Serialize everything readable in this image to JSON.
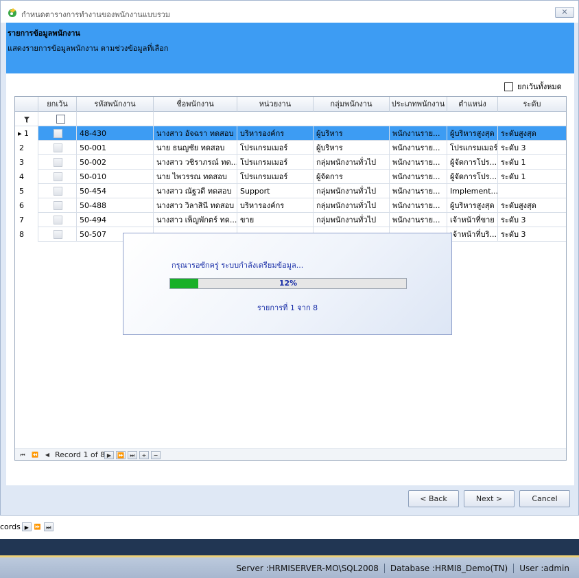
{
  "window": {
    "title": "กำหนดตารางการทำงานของพนักงานแบบรวม",
    "close_label": "✕"
  },
  "banner": {
    "heading": "รายการข้อมูลพนักงาน",
    "description": "แสดงรายการข้อมูลพนักงาน ตามช่วงข้อมูลที่เลือก"
  },
  "exclude_all_label": "ยกเว้นทั้งหมด",
  "grid": {
    "columns": [
      "ยกเว้น",
      "รหัสพนักงาน",
      "ชื่อพนักงาน",
      "หน่วยงาน",
      "กลุ่มพนักงาน",
      "ประเภทพนักงาน",
      "ตำแหน่ง",
      "ระดับ"
    ],
    "filter_icon": "filter-icon",
    "rows": [
      {
        "no": "1",
        "code": "48-430",
        "name": "นางสาว อัจฉรา ทดสอบ",
        "dept": "บริหารองค์กร",
        "group": "ผู้บริหาร",
        "type": "พนักงานราย...",
        "position": "ผู้บริหารสูงสุด",
        "level": "ระดับสูงสุด"
      },
      {
        "no": "2",
        "code": "50-001",
        "name": "นาย ธนญชัย ทดสอบ",
        "dept": "โปรแกรมเมอร์",
        "group": "ผู้บริหาร",
        "type": "พนักงานราย...",
        "position": "โปรแกรมเมอร์",
        "level": "ระดับ 3"
      },
      {
        "no": "3",
        "code": "50-002",
        "name": "นางสาว วชิราภรณ์ ทด...",
        "dept": "โปรแกรมเมอร์",
        "group": "กลุ่มพนักงานทั่วไป",
        "type": "พนักงานราย...",
        "position": "ผู้จัดการโปร...",
        "level": "ระดับ 1"
      },
      {
        "no": "4",
        "code": "50-010",
        "name": "นาย ไพวรรณ ทดสอบ",
        "dept": "โปรแกรมเมอร์",
        "group": "ผู้จัดการ",
        "type": "พนักงานราย...",
        "position": "ผู้จัดการโปร...",
        "level": "ระดับ 1"
      },
      {
        "no": "5",
        "code": "50-454",
        "name": "นางสาว ณัฐวดี ทดสอบ",
        "dept": "Support",
        "group": "กลุ่มพนักงานทั่วไป",
        "type": "พนักงานราย...",
        "position": "Implement...",
        "level": ""
      },
      {
        "no": "6",
        "code": "50-488",
        "name": "นางสาว วิลาสินี ทดสอบ",
        "dept": "บริหารองค์กร",
        "group": "กลุ่มพนักงานทั่วไป",
        "type": "พนักงานราย...",
        "position": "ผู้บริหารสูงสุด",
        "level": "ระดับสูงสุด"
      },
      {
        "no": "7",
        "code": "50-494",
        "name": "นางสาว เพ็ญพักตร์ ทด...",
        "dept": "ขาย",
        "group": "กลุ่มพนักงานทั่วไป",
        "type": "พนักงานราย...",
        "position": "เจ้าหน้าที่ขาย",
        "level": "ระดับ 3"
      },
      {
        "no": "8",
        "code": "50-507",
        "name": "",
        "dept": "",
        "group": "",
        "type": "",
        "position": "เจ้าหน้าที่บริ...",
        "level": "ระดับ 3"
      }
    ],
    "navigator_text": "Record 1 of 8"
  },
  "progress_dialog": {
    "message": "กรุณารอซักครู่ ระบบกำลังเตรียมข้อมูล...",
    "percent_label": "12%",
    "percent": 12,
    "sub_text": "รายการที่ 1 จาก 8",
    "fill_color": "#18b028"
  },
  "buttons": {
    "back": "< Back",
    "next": "Next >",
    "cancel": "Cancel"
  },
  "background_navigator": {
    "text": "cords"
  },
  "status_bar": {
    "server": "Server :HRMISERVER-MO\\SQL2008",
    "database": "Database :HRMI8_Demo(TN)",
    "user": "User :admin"
  },
  "colors": {
    "banner": "#3d9cf3",
    "selected_row": "#3d9cf3",
    "dark_band": "#213653",
    "accent_line": "#ecd078"
  }
}
